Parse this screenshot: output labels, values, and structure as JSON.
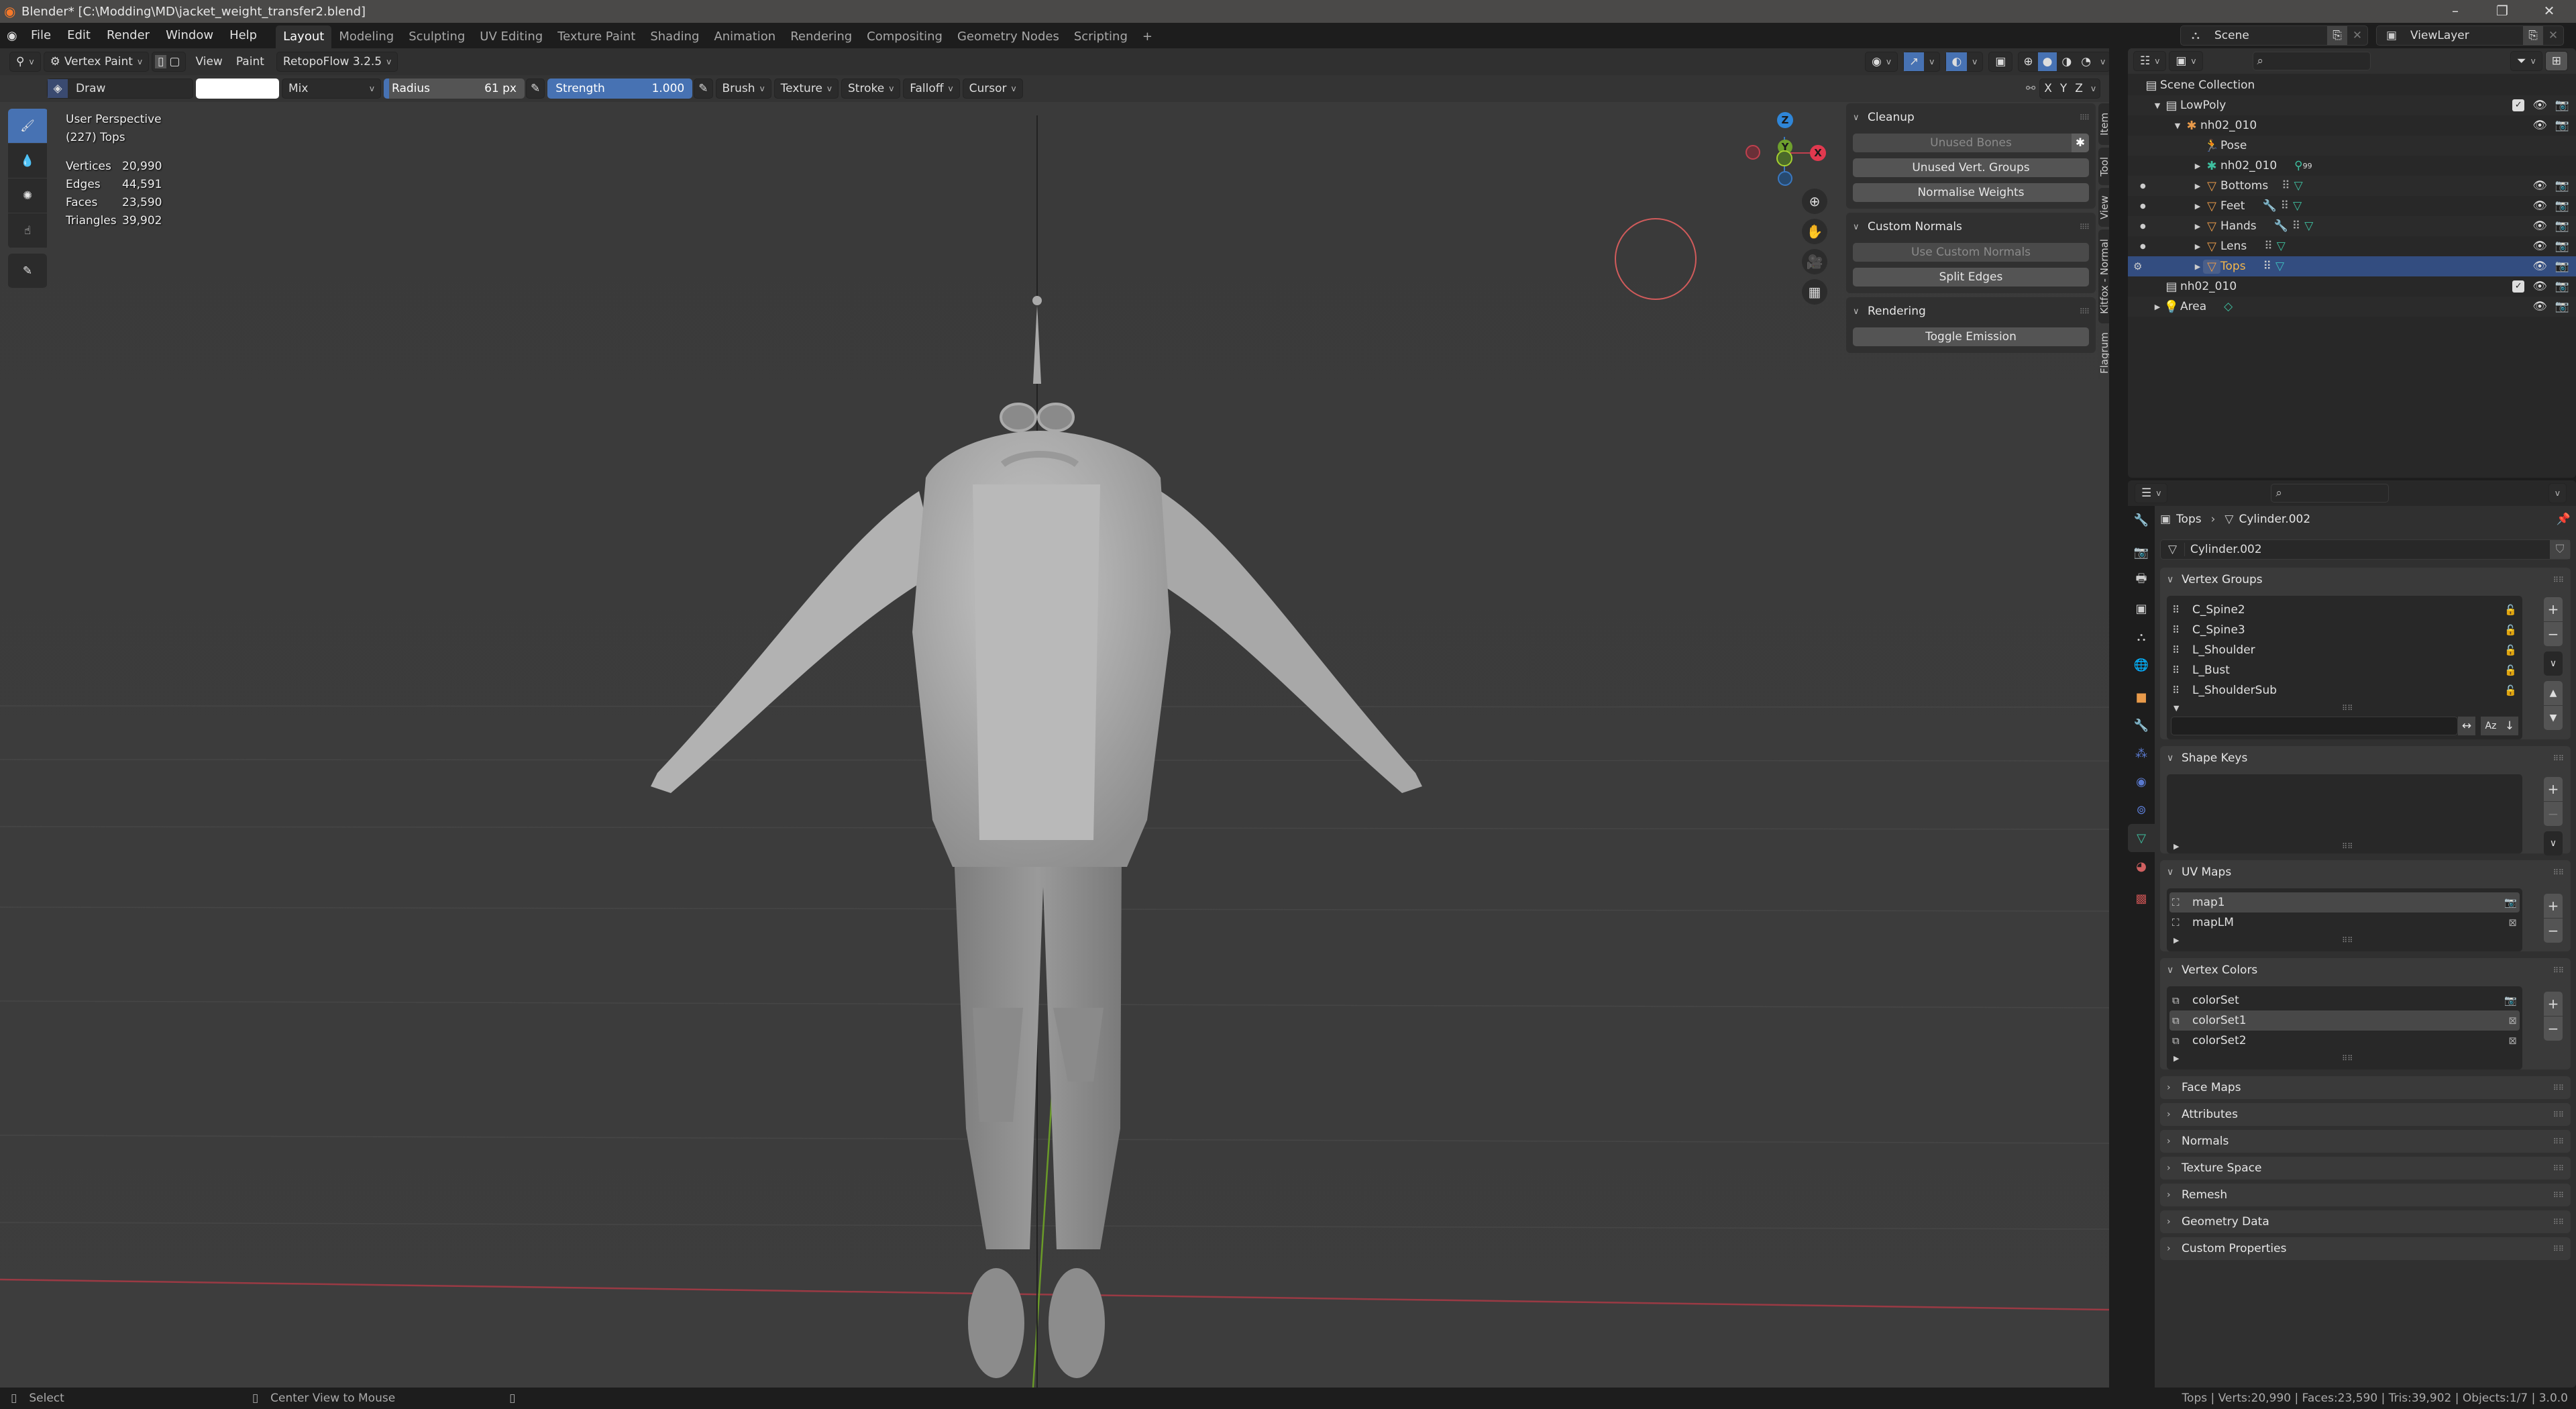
{
  "window": {
    "title": "Blender* [C:\\Modding\\MD\\jacket_weight_transfer2.blend]",
    "controls": [
      "minimize",
      "maximize",
      "close"
    ]
  },
  "menu": {
    "items": [
      "File",
      "Edit",
      "Render",
      "Window",
      "Help"
    ],
    "workspaces": [
      "Layout",
      "Modeling",
      "Sculpting",
      "UV Editing",
      "Texture Paint",
      "Shading",
      "Animation",
      "Rendering",
      "Compositing",
      "Geometry Nodes",
      "Scripting"
    ],
    "active_workspace": "Layout",
    "add_tab": "+"
  },
  "scene_selector": {
    "value": "Scene"
  },
  "viewlayer_selector": {
    "value": "ViewLayer"
  },
  "viewport_header": {
    "mode": "Vertex Paint",
    "view": "View",
    "paint": "Paint",
    "addon": "RetopoFlow 3.2.5"
  },
  "tool_settings": {
    "brush_name": "Draw",
    "color_hex": "#ffffff",
    "blend_mode": "Mix",
    "radius_label": "Radius",
    "radius_value": "61 px",
    "strength_label": "Strength",
    "strength_value": "1.000",
    "menus": [
      "Brush",
      "Texture",
      "Stroke",
      "Falloff",
      "Cursor"
    ],
    "mirror_axes": [
      "X",
      "Y",
      "Z"
    ]
  },
  "viewport_overlay": {
    "view_name": "User Perspective",
    "object_info": "(227) Tops",
    "stats": [
      {
        "label": "Vertices",
        "value": "20,990"
      },
      {
        "label": "Edges",
        "value": "44,591"
      },
      {
        "label": "Faces",
        "value": "23,590"
      },
      {
        "label": "Triangles",
        "value": "39,902"
      }
    ]
  },
  "gizmo": {
    "x": "X",
    "y": "Y",
    "z": "Z"
  },
  "npanel": {
    "tabs": [
      "Item",
      "Tool",
      "View",
      "Kitfox - Normal",
      "Flagrum"
    ],
    "active_tab": "Flagrum",
    "sections": [
      {
        "title": "Cleanup",
        "buttons": [
          {
            "label": "Unused Bones",
            "disabled": true
          },
          {
            "label": "Unused Vert. Groups",
            "disabled": false
          },
          {
            "label": "Normalise Weights",
            "disabled": false
          }
        ]
      },
      {
        "title": "Custom Normals",
        "buttons": [
          {
            "label": "Use Custom Normals",
            "disabled": true
          },
          {
            "label": "Split Edges",
            "disabled": false
          }
        ]
      },
      {
        "title": "Rendering",
        "buttons": [
          {
            "label": "Toggle Emission",
            "disabled": false
          }
        ]
      }
    ]
  },
  "outliner": {
    "root": "Scene Collection",
    "rows": [
      {
        "name": "LowPoly",
        "depth": 1,
        "icon": "collection",
        "expanded": true
      },
      {
        "name": "nh02_010",
        "depth": 2,
        "icon": "armature-object",
        "expanded": true
      },
      {
        "name": "Pose",
        "depth": 3,
        "icon": "pose"
      },
      {
        "name": "nh02_010",
        "depth": 3,
        "icon": "armature-data",
        "badge": "99"
      },
      {
        "name": "Bottoms",
        "depth": 3,
        "icon": "mesh-object"
      },
      {
        "name": "Feet",
        "depth": 3,
        "icon": "mesh-object"
      },
      {
        "name": "Hands",
        "depth": 3,
        "icon": "mesh-object"
      },
      {
        "name": "Lens",
        "depth": 3,
        "icon": "mesh-object"
      },
      {
        "name": "Tops",
        "depth": 3,
        "icon": "mesh-object",
        "selected": true
      },
      {
        "name": "nh02_010",
        "depth": 1,
        "icon": "collection"
      },
      {
        "name": "Area",
        "depth": 1,
        "icon": "light"
      }
    ]
  },
  "properties": {
    "breadcrumb_object": "Tops",
    "breadcrumb_data": "Cylinder.002",
    "mesh_name": "Cylinder.002",
    "vertex_groups": {
      "title": "Vertex Groups",
      "items": [
        "C_Spine2",
        "C_Spine3",
        "L_Shoulder",
        "L_Bust",
        "L_ShoulderSub"
      ],
      "filter_value": ""
    },
    "shape_keys": {
      "title": "Shape Keys",
      "items": []
    },
    "uv_maps": {
      "title": "UV Maps",
      "items": [
        "map1",
        "mapLM"
      ],
      "active": "map1"
    },
    "vertex_colors": {
      "title": "Vertex Colors",
      "items": [
        "colorSet",
        "colorSet1",
        "colorSet2"
      ],
      "active": "colorSet1"
    },
    "collapsed_sections": [
      "Face Maps",
      "Attributes",
      "Normals",
      "Texture Space",
      "Remesh",
      "Geometry Data",
      "Custom Properties"
    ]
  },
  "statusbar": {
    "left_hint": "Select",
    "middle_hint": "Center View to Mouse",
    "right_info": "Tops | Verts:20,990 | Faces:23,590 | Tris:39,902 | Objects:1/7 | 3.0.0"
  },
  "colors": {
    "accent_blue": "#4772b3",
    "selection_row": "#334d80",
    "axis_x": "#e2394f",
    "axis_y": "#6ea02d",
    "axis_z": "#2f86d8",
    "object_orange": "#e89a4a",
    "data_green": "#3ec0a0"
  }
}
